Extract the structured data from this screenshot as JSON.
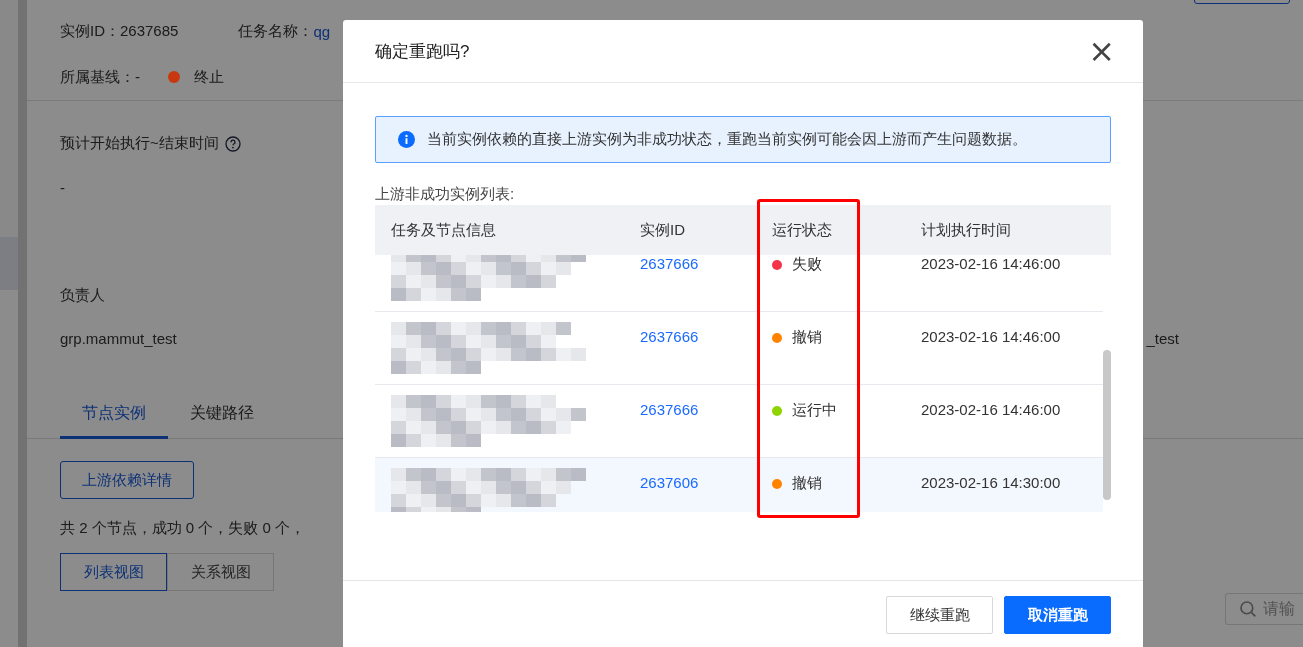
{
  "page": {
    "instance_id": "实例ID：2637685",
    "task_name_label": "任务名称：",
    "task_name_value": "qg",
    "baseline": "所属基线：-",
    "run_status": {
      "label": "终止",
      "color": "#c8380f"
    },
    "time_label": "预计开始执行~结束时间",
    "time_value": "-",
    "owner_label": "负责人",
    "owner_value": "grp.mammut_test",
    "right_value": "_test",
    "tabs": [
      {
        "label": "节点实例",
        "selected": true
      },
      {
        "label": "关键路径",
        "selected": false
      }
    ],
    "upstream_button": "上游依赖详情",
    "summary": "共 2 个节点，成功 0 个，失败 0 个，",
    "views": [
      {
        "label": "列表视图",
        "selected": true
      },
      {
        "label": "关系视图",
        "selected": false
      }
    ],
    "search": {
      "placeholder": "请输"
    }
  },
  "dialog": {
    "title": "确定重跑吗?",
    "close": "×",
    "alert": "当前实例依赖的直接上游实例为非成功状态，重跑当前实例可能会因上游而产生问题数据。",
    "list_label": "上游非成功实例列表:",
    "columns": [
      "任务及节点信息",
      "实例ID",
      "运行状态",
      "计划执行时间"
    ],
    "rows": [
      {
        "instance_id": "2637666",
        "status": {
          "label": "失败",
          "color": "#f5334a"
        },
        "planned_time": "2023-02-16 14:46:00",
        "selected": false
      },
      {
        "instance_id": "2637666",
        "status": {
          "label": "撤销",
          "color": "#ff8200"
        },
        "planned_time": "2023-02-16 14:46:00",
        "selected": false
      },
      {
        "instance_id": "2637666",
        "status": {
          "label": "运行中",
          "color": "#8fd400"
        },
        "planned_time": "2023-02-16 14:46:00",
        "selected": false
      },
      {
        "instance_id": "2637606",
        "status": {
          "label": "撤销",
          "color": "#ff8200"
        },
        "planned_time": "2023-02-16 14:30:00",
        "selected": true
      }
    ],
    "buttons": [
      {
        "label": "继续重跑",
        "kind": "default"
      },
      {
        "label": "取消重跑",
        "kind": "primary"
      }
    ]
  }
}
